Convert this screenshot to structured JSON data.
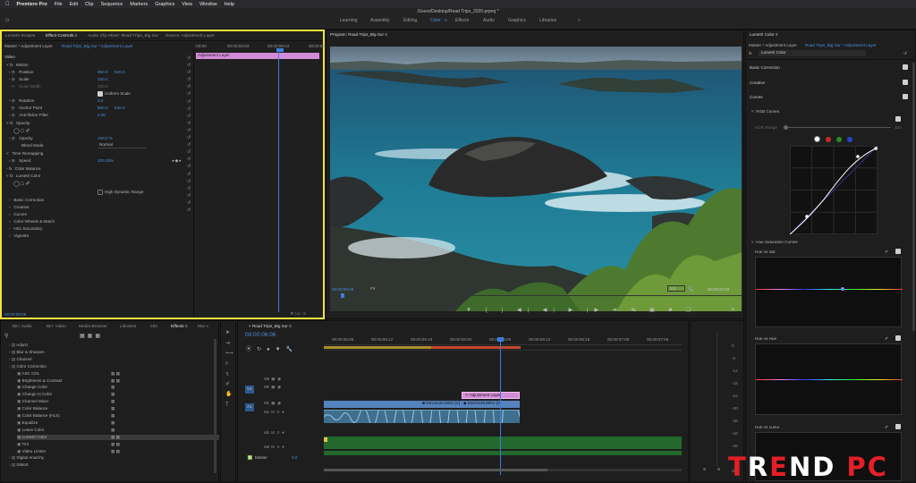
{
  "menubar": {
    "apple": "",
    "app": "Premiere Pro",
    "items": [
      "File",
      "Edit",
      "Clip",
      "Sequence",
      "Markers",
      "Graphics",
      "View",
      "Window",
      "Help"
    ]
  },
  "window": {
    "title": "/Users/Desktop/Road Trips_2020.prproj *"
  },
  "workspaces": {
    "items": [
      "Learning",
      "Assembly",
      "Editing",
      "Color",
      "Effects",
      "Audio",
      "Graphics",
      "Libraries"
    ],
    "more": "»",
    "active": "Color"
  },
  "effect_controls": {
    "tabs": [
      "Lumetri Scopes",
      "Effect Controls",
      "Audio Clip Mixer: Road Trips_Big Sur",
      "Source: Adjustment Layer"
    ],
    "master": "Master * Adjustment Layer",
    "seq": "Road Trips_Big Sur * Adjustment Layer",
    "ruler": [
      ":00:00",
      "00:00:06:03",
      "00:00:06:04",
      "00:00:06:5"
    ],
    "clip": "Adjustment Layer",
    "section_video": "Video",
    "motion": "Motion",
    "position": {
      "label": "Position",
      "x": "960.0",
      "y": "540.0"
    },
    "scale": {
      "label": "Scale",
      "value": "100.0"
    },
    "scale_width": {
      "label": "Scale Width",
      "value": "100.0"
    },
    "uniform": "Uniform Scale",
    "rotation": {
      "label": "Rotation",
      "value": "0.0"
    },
    "anchor": {
      "label": "Anchor Point",
      "x": "960.0",
      "y": "540.0"
    },
    "flicker": {
      "label": "Anti-flicker Filter",
      "value": "0.00"
    },
    "opacity": "Opacity",
    "opacity_val": {
      "label": "Opacity",
      "value": "100.0 %"
    },
    "blend": {
      "label": "Blend Mode",
      "value": "Normal"
    },
    "time_remap": "Time Remapping",
    "speed": {
      "label": "Speed",
      "value": "100.00%"
    },
    "color_balance": "Color Balance",
    "lumetri": "Lumetri Color",
    "hdr": "High Dynamic Range",
    "sub": [
      "Basic Correction",
      "Creative",
      "Curves",
      "Color Wheels & Match",
      "HSL Secondary",
      "Vignette"
    ],
    "timecode": "00:00:06:06"
  },
  "program": {
    "tab": "Program: Road Trips_Big Sur",
    "timecode": "00:00:06:06",
    "fit": "Fit",
    "res": "1/2",
    "duration": "00:03:22:02"
  },
  "lumetri": {
    "tab": "Lumetri Color",
    "master": "Master * Adjustment Layer",
    "seq": "Road Trips_Big Sur * Adjustment Layer",
    "fx": "fx",
    "effect": "Lumetri Color",
    "sections": [
      "Basic Correction",
      "Creative",
      "Curves"
    ],
    "rgb_curves": "RGB Curves",
    "hdr_range": "HDR Range",
    "hdr_max": "100",
    "hue_sat": "Hue Saturation Curves",
    "hue_vs_sat": "Hue vs Sat",
    "hue_vs_hue": "Hue vs Hue",
    "hue_vs_luma": "Hue vs Luma"
  },
  "effects_panel": {
    "tabs": [
      "Bin: Audio",
      "Bin: Video",
      "Media Browser",
      "Libraries",
      "Info",
      "Effects",
      "Mar"
    ],
    "items": [
      "Adjust",
      "Blur & Sharpen",
      "Channel",
      "Color Correction",
      "ASC CDL",
      "Brightness & Contrast",
      "Change Color",
      "Change to Color",
      "Channel Mixer",
      "Color Balance",
      "Color Balance (HLS)",
      "Equalize",
      "Leave Color",
      "Lumetri Color",
      "Tint",
      "Video Limiter",
      "Digital Anarchy",
      "Distort"
    ]
  },
  "timeline": {
    "tab": "Road Trips_Big Sur",
    "timecode": "00:00:06:06",
    "ruler": [
      "00:00:05:06",
      "00:00:05:12",
      "00:00:05:18",
      "00:00:06:00",
      "00:00:06:06",
      "00:00:06:12",
      "00:00:06:18",
      "00:00:07:00",
      "00:00:07:06"
    ],
    "tracks": [
      "V3",
      "V2",
      "V1",
      "A1",
      "A2",
      "A3"
    ],
    "master": {
      "label": "Master",
      "value": "0.0"
    },
    "clip_adj": "Adjustment Layer",
    "clip_v1a": "DSC5120.MOV [V]",
    "clip_v1b": "DSC5119.MOV [V]"
  },
  "meter": {
    "scale": [
      "0",
      "-6",
      "-12",
      "-18",
      "-24",
      "-30",
      "-36",
      "-42",
      "-48",
      "-54",
      "dB"
    ],
    "s": "S",
    "s2": "S"
  },
  "watermark": {
    "text": "TREND PC"
  },
  "colors": {
    "accent": "#4c8fe0",
    "highlight": "#f1e33c",
    "clip_pink": "#d48bd7",
    "video_blue": "#4f7fb9",
    "audio_green": "#2d7d3a",
    "playhead": "#3d7de0"
  }
}
